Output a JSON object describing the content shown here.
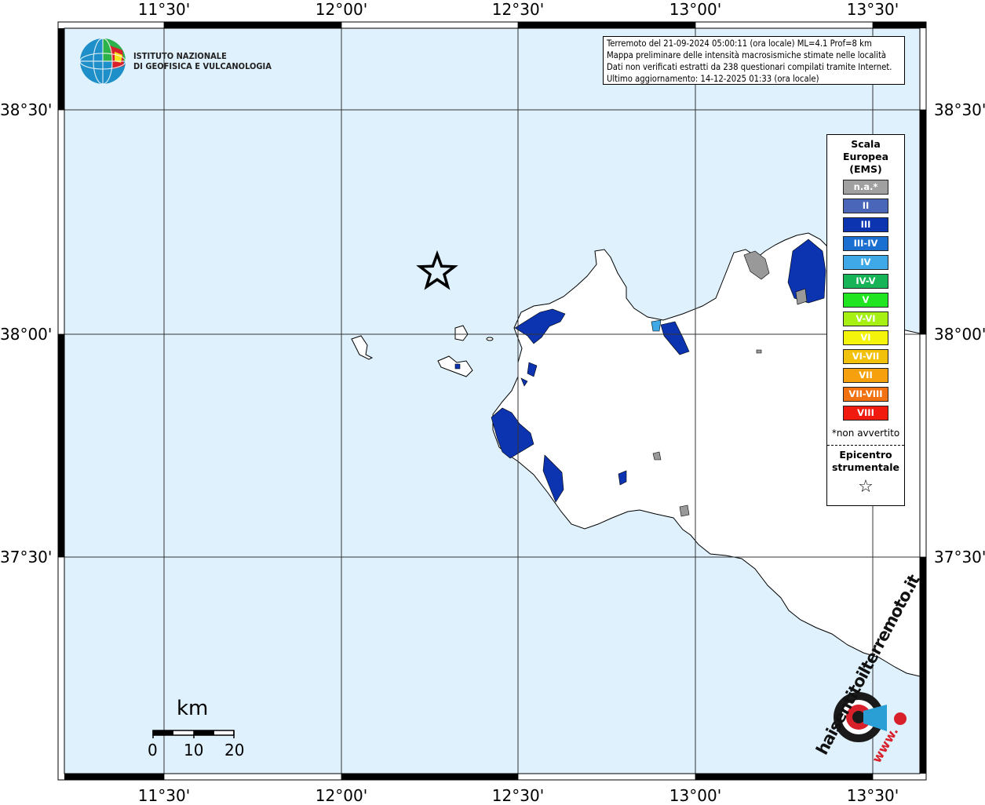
{
  "map": {
    "info_lines": [
      "Terremoto del 21-09-2024 05:00:11 (ora locale) ML=4.1 Prof=8 km",
      "Mappa preliminare delle intensità macrosismiche stimate nelle località",
      "Dati non verificati estratti da 238 questionari compilati tramite Internet.",
      "Ultimo aggiornamento: 14-12-2025 01:33 (ora locale)"
    ],
    "ingv_logo_lines": [
      "ISTITUTO NAZIONALE",
      "DI GEOFISICA E VULCANOLOGIA"
    ],
    "lon_ticks": [
      "11°30'",
      "12°00'",
      "12°30'",
      "13°00'",
      "13°30'"
    ],
    "lat_ticks": [
      "38°30'",
      "38°00'",
      "37°30'"
    ],
    "scale_bar": {
      "unit": "km",
      "labels": [
        "0",
        "10",
        "20"
      ]
    },
    "watermark_text": "haisentitoilterremoto.it",
    "watermark_url": "www.",
    "colors": {
      "sea": "#dff1fc",
      "land": "#ffffff",
      "intensity_III": "#0c34b0",
      "intensity_IV": "#3ea9e6",
      "na": "#999999"
    }
  },
  "legend": {
    "title_lines": [
      "Scala",
      "Europea",
      "(EMS)"
    ],
    "items": [
      {
        "label": "n.a.*",
        "color": "#a0a0a0"
      },
      {
        "label": "II",
        "color": "#4966b8"
      },
      {
        "label": "III",
        "color": "#0c34b0"
      },
      {
        "label": "III-IV",
        "color": "#1b6fd0"
      },
      {
        "label": "IV",
        "color": "#3ea9e6"
      },
      {
        "label": "IV-V",
        "color": "#16b457"
      },
      {
        "label": "V",
        "color": "#21e521"
      },
      {
        "label": "V-VI",
        "color": "#a6f014"
      },
      {
        "label": "VI",
        "color": "#f4f40a"
      },
      {
        "label": "VI-VII",
        "color": "#f2c10b"
      },
      {
        "label": "VII",
        "color": "#f5a00c"
      },
      {
        "label": "VII-VIII",
        "color": "#f27111"
      },
      {
        "label": "VIII",
        "color": "#f01a0e"
      }
    ],
    "footnote": "*non avvertito",
    "epicenter_lines": [
      "Epicentro",
      "strumentale"
    ],
    "epicenter_symbol": "☆"
  }
}
